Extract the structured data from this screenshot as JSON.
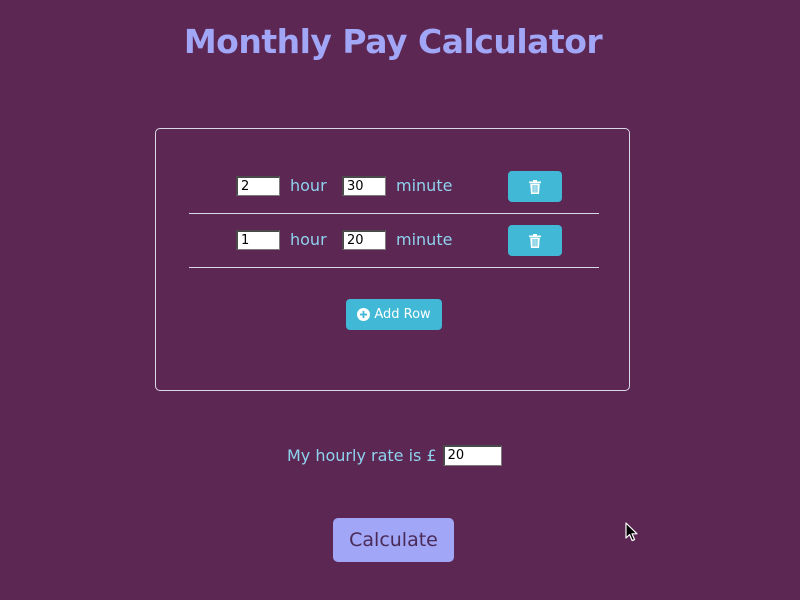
{
  "header": {
    "title": "Monthly Pay Calculator"
  },
  "rows": [
    {
      "hours": "2",
      "hour_label": "hour",
      "minutes": "30",
      "minute_label": "minute",
      "delete_icon": "trash-icon"
    },
    {
      "hours": "1",
      "hour_label": "hour",
      "minutes": "20",
      "minute_label": "minute",
      "delete_icon": "trash-icon"
    }
  ],
  "add_row": {
    "label": "Add Row",
    "icon": "plus-circle-icon"
  },
  "rate": {
    "label": "My hourly rate is £",
    "value": "20"
  },
  "calculate": {
    "label": "Calculate"
  },
  "colors": {
    "background": "#5c2752",
    "title": "#a1a6f7",
    "label_text": "#8fd3ef",
    "button_accent": "#41b8d6",
    "calculate_button": "#a1a6f7",
    "panel_border": "#d8d8e6"
  }
}
